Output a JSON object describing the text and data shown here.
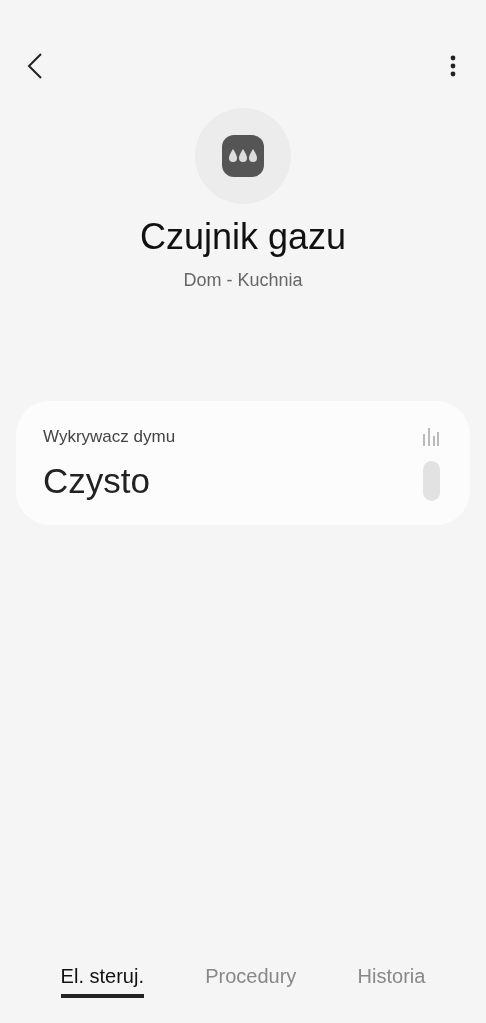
{
  "device": {
    "name": "Czujnik gazu",
    "location": "Dom - Kuchnia"
  },
  "card": {
    "label": "Wykrywacz dymu",
    "status": "Czysto"
  },
  "tabs": [
    {
      "label": "El. steruj.",
      "selected": true
    },
    {
      "label": "Procedury",
      "selected": false
    },
    {
      "label": "Historia",
      "selected": false
    }
  ]
}
